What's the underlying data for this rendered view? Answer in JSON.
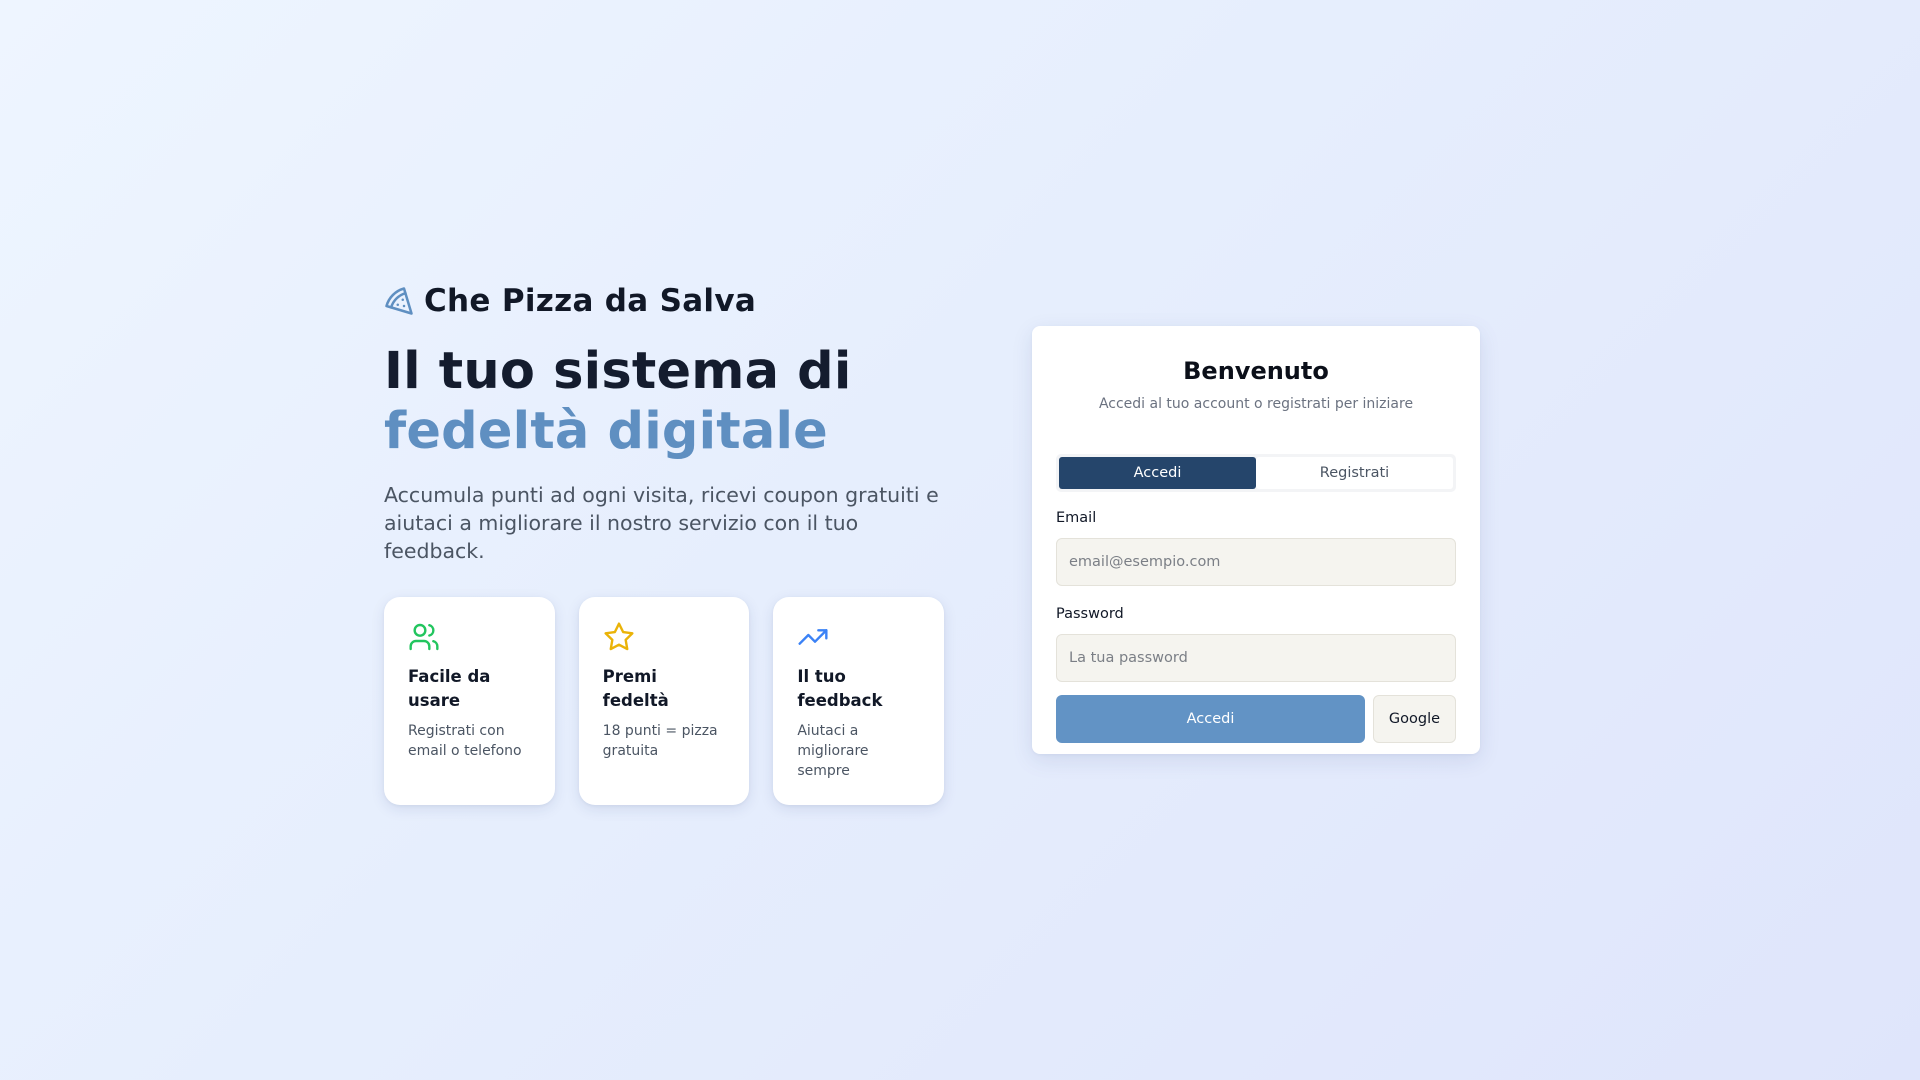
{
  "brand": {
    "name": "Che Pizza da Salva",
    "icon": "pizza-slice-icon",
    "accent_color": "#5f8fc1"
  },
  "hero": {
    "headline_line1": "Il tuo sistema di",
    "headline_line2": "fedeltà digitale",
    "intro": "Accumula punti ad ogni visita, ricevi coupon gratuiti e aiutaci a migliorare il nostro servizio con il tuo feedback."
  },
  "features": [
    {
      "icon": "users-icon",
      "color": "#22c55e",
      "title": "Facile da usare",
      "desc": "Registrati con email o telefono"
    },
    {
      "icon": "star-icon",
      "color": "#eab308",
      "title": "Premi fedeltà",
      "desc": "18 punti = pizza gratuita"
    },
    {
      "icon": "trending-up-icon",
      "color": "#3b82f6",
      "title": "Il tuo feedback",
      "desc": "Aiutaci a migliorare sempre"
    }
  ],
  "login": {
    "title": "Benvenuto",
    "subtitle": "Accedi al tuo account o registrati per iniziare",
    "tabs": [
      {
        "label": "Accedi",
        "active": true
      },
      {
        "label": "Registrati",
        "active": false
      }
    ],
    "email": {
      "label": "Email",
      "placeholder": "email@esempio.com",
      "value": ""
    },
    "password": {
      "label": "Password",
      "placeholder": "La tua password",
      "value": ""
    },
    "submit_label": "Accedi",
    "google_label": "Google",
    "primary_color": "#6293c5",
    "tab_active_color": "#25456b"
  }
}
